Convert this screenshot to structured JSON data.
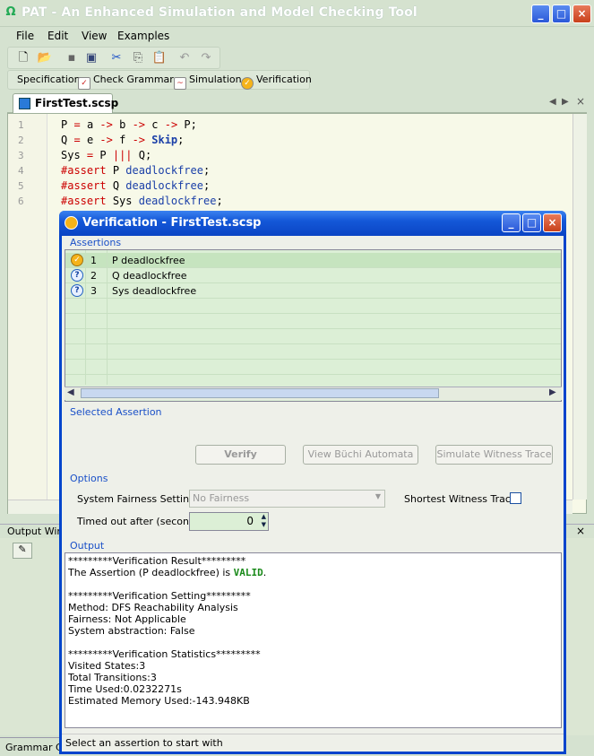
{
  "app": {
    "title": "PAT - An Enhanced Simulation and Model Checking Tool"
  },
  "menu": [
    "File",
    "Edit",
    "View",
    "Examples"
  ],
  "toolbar2": [
    "Specification",
    "Check Grammar",
    "Simulation",
    "Verification"
  ],
  "tab": {
    "label": "FirstTest.scsp"
  },
  "code": {
    "lines": [
      {
        "n": "1",
        "text": "P = a -> b -> c -> P;"
      },
      {
        "n": "2",
        "text": "Q = e -> f -> Skip;"
      },
      {
        "n": "3",
        "text": "Sys = P ||| Q;"
      },
      {
        "n": "4",
        "text": "#assert P deadlockfree;"
      },
      {
        "n": "5",
        "text": "#assert Q deadlockfree;"
      },
      {
        "n": "6",
        "text": "#assert Sys deadlockfree;"
      }
    ]
  },
  "output_window": {
    "title": "Output Wind"
  },
  "grammar_tab": "Grammar Ch",
  "dialog": {
    "title": "Verification - FirstTest.scsp",
    "assertions_label": "Assertions",
    "assertions": [
      {
        "n": "1",
        "text": "P deadlockfree",
        "status": "valid"
      },
      {
        "n": "2",
        "text": "Q deadlockfree",
        "status": "unknown"
      },
      {
        "n": "3",
        "text": "Sys deadlockfree",
        "status": "unknown"
      }
    ],
    "selected_label": "Selected Assertion",
    "buttons": {
      "verify": "Verify",
      "buchi": "View Büchi Automata",
      "witness": "Simulate Witness Trace"
    },
    "options_label": "Options",
    "fairness_label": "System Fairness Setting",
    "fairness_value": "No Fairness",
    "shortest_label": "Shortest Witness Trace",
    "timeout_label": "Timed out after (seconds)",
    "timeout_value": "0",
    "output_label": "Output",
    "output_lines": [
      "*********Verification Result*********",
      "",
      "",
      "*********Verification Setting*********",
      "Method: DFS Reachability Analysis",
      "Fairness: Not Applicable",
      "System abstraction: False",
      "",
      "*********Verification Statistics*********",
      "Visited States:3",
      "Total Transitions:3",
      "Time Used:0.0232271s",
      "Estimated Memory Used:-143.948KB"
    ],
    "result": {
      "prefix": "The Assertion (P deadlockfree) is ",
      "verdict": "VALID",
      "suffix": "."
    },
    "status": "Select an assertion to start with"
  },
  "colors": {
    "keyword": "#cc0000",
    "ident": "#1a3fa8",
    "valid": "#1a8a1a",
    "dialog_border": "#0044cc"
  }
}
